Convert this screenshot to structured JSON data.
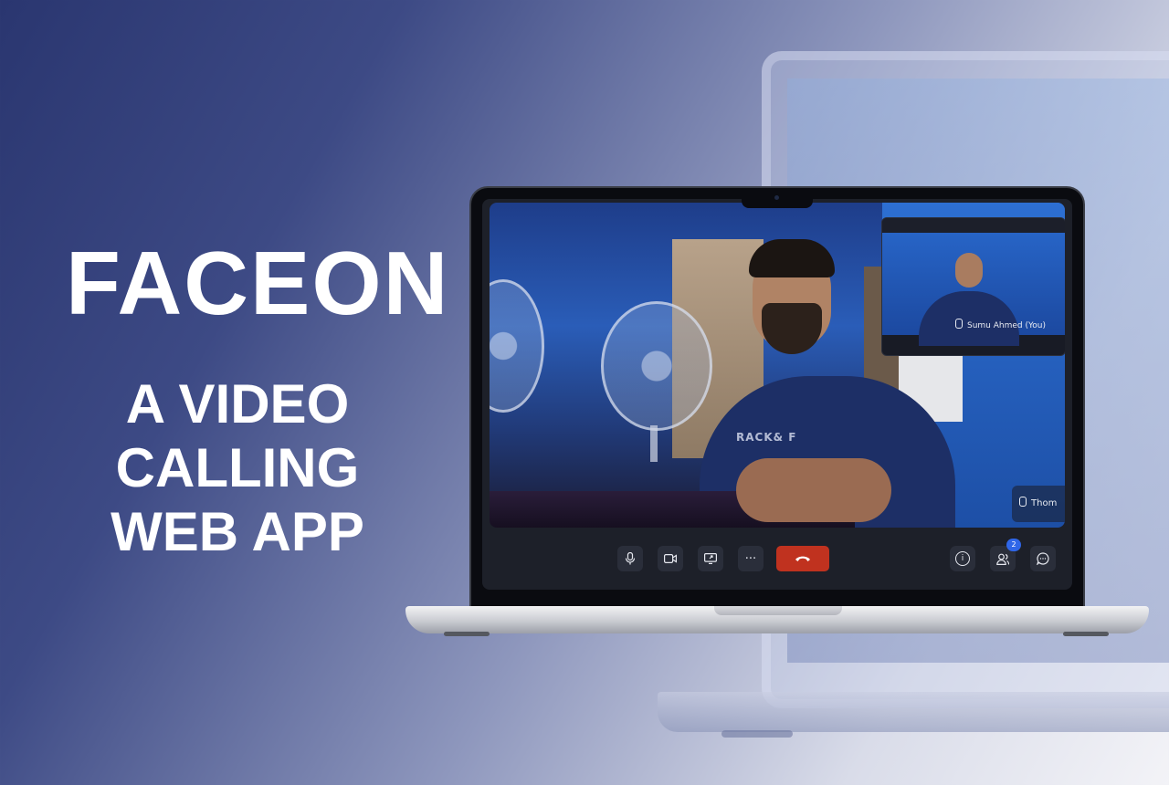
{
  "hero": {
    "title": "FACEON",
    "subtitle_line1": "A VIDEO",
    "subtitle_line2": "CALLING",
    "subtitle_line3": "WEB APP"
  },
  "call": {
    "self_name": "Sumu Ahmed (You)",
    "remote_name": "Thom",
    "participant_count": "2",
    "shirt_print": "RACK& F"
  },
  "controls": {
    "mic_icon": "mic-icon",
    "camera_icon": "camera-icon",
    "share_icon": "screen-share-icon",
    "more_label": "···",
    "end_icon": "phone-hangup-icon",
    "info_label": "i",
    "people_icon": "participants-icon",
    "chat_icon": "chat-icon"
  },
  "colors": {
    "end_call": "#c0321f",
    "badge": "#2f66e8",
    "control_bg": "#2a2e3a"
  }
}
